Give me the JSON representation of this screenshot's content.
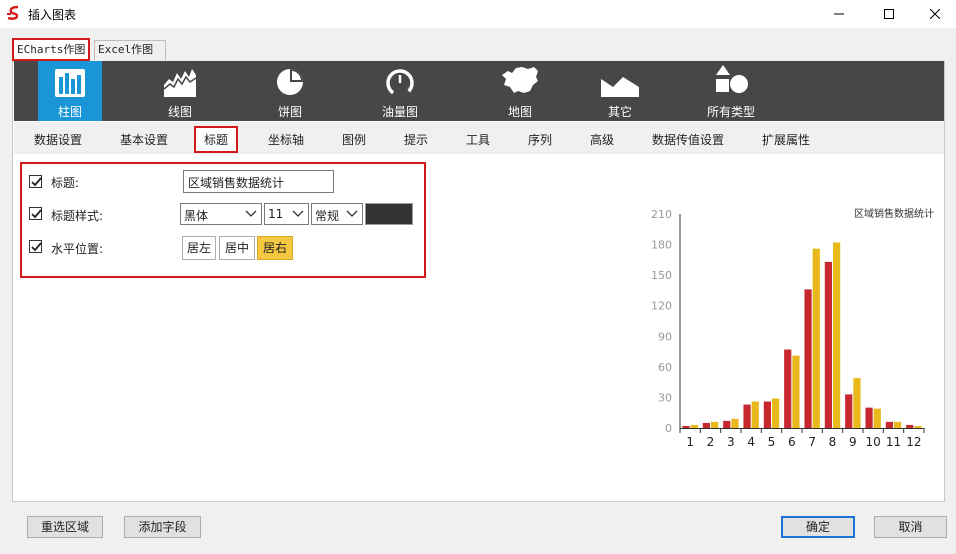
{
  "window": {
    "title": "插入图表"
  },
  "top_tabs": [
    {
      "label": "ECharts作图"
    },
    {
      "label": "Excel作图"
    }
  ],
  "chart_types": [
    {
      "label": "柱图",
      "icon": "bar-chart-icon"
    },
    {
      "label": "线图",
      "icon": "line-chart-icon"
    },
    {
      "label": "饼图",
      "icon": "pie-chart-icon"
    },
    {
      "label": "油量图",
      "icon": "gauge-icon"
    },
    {
      "label": "地图",
      "icon": "map-icon"
    },
    {
      "label": "其它",
      "icon": "other-chart-icon"
    },
    {
      "label": "所有类型",
      "icon": "shapes-icon"
    }
  ],
  "settings_tabs": [
    {
      "label": "数据设置"
    },
    {
      "label": "基本设置"
    },
    {
      "label": "标题"
    },
    {
      "label": "坐标轴"
    },
    {
      "label": "图例"
    },
    {
      "label": "提示"
    },
    {
      "label": "工具"
    },
    {
      "label": "序列"
    },
    {
      "label": "高级"
    },
    {
      "label": "数据传值设置"
    },
    {
      "label": "扩展属性"
    }
  ],
  "form": {
    "title_label": "标题:",
    "title_value": "区域销售数据统计",
    "style_label": "标题样式:",
    "font_family": "黑体",
    "font_size": "11",
    "font_weight": "常规",
    "font_color": "#333333",
    "position_label": "水平位置:",
    "align_left": "居左",
    "align_center": "居中",
    "align_right": "居右",
    "align_selected": "居右"
  },
  "chart_data": {
    "type": "bar",
    "title": "区域销售数据统计",
    "categories": [
      "1",
      "2",
      "3",
      "4",
      "5",
      "6",
      "7",
      "8",
      "9",
      "10",
      "11",
      "12"
    ],
    "series": [
      {
        "color": "#c6282d",
        "values": [
          2,
          5,
          7,
          23,
          26,
          77,
          136,
          163,
          33,
          20,
          6,
          3
        ]
      },
      {
        "color": "#e8b81c",
        "values": [
          3,
          6,
          9,
          26,
          29,
          71,
          176,
          182,
          49,
          19,
          6,
          2
        ]
      }
    ],
    "yticks": [
      "0",
      "30",
      "60",
      "90",
      "120",
      "150",
      "180",
      "210"
    ],
    "ylim": [
      0,
      210
    ]
  },
  "buttons": {
    "reselect": "重选区域",
    "add_field": "添加字段",
    "ok": "确定",
    "cancel": "取消"
  }
}
